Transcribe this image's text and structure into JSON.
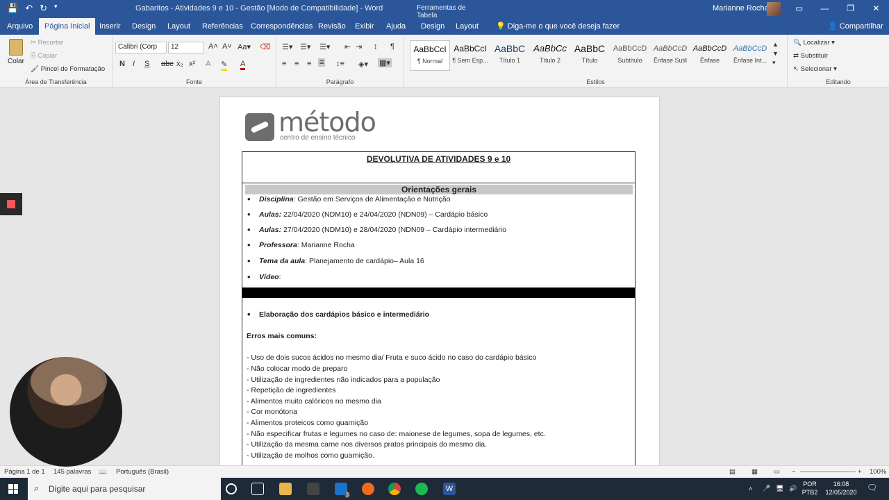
{
  "titlebar": {
    "doc_title": "Gabaritos - Atividades 9 e 10 - Gestão [Modo de Compatibilidade] - Word",
    "context_tools": "Ferramentas de Tabela",
    "user_name": "Marianne Rocha"
  },
  "tabs": [
    "Arquivo",
    "Página Inicial",
    "Inserir",
    "Design",
    "Layout",
    "Referências",
    "Correspondências",
    "Revisão",
    "Exibir",
    "Ajuda",
    "Design",
    "Layout"
  ],
  "tell_me": "Diga-me o que você deseja fazer",
  "share": "Compartilhar",
  "clipboard": {
    "paste": "Colar",
    "cut": "Recortar",
    "copy": "Copiar",
    "format_painter": "Pincel de Formatação",
    "label": "Área de Transferência"
  },
  "font": {
    "name": "Calibri (Corp",
    "size": "12",
    "label": "Fonte"
  },
  "paragraph": {
    "label": "Parágrafo"
  },
  "styles": {
    "label": "Estilos",
    "items": [
      {
        "preview": "AaBbCcI",
        "name": "¶ Normal"
      },
      {
        "preview": "AaBbCcI",
        "name": "¶ Sem Esp..."
      },
      {
        "preview": "AaBbC",
        "name": "Título 1"
      },
      {
        "preview": "AaBbCc",
        "name": "Título 2"
      },
      {
        "preview": "AaBbC",
        "name": "Título"
      },
      {
        "preview": "AaBbCcD",
        "name": "Subtítulo"
      },
      {
        "preview": "AaBbCcD",
        "name": "Ênfase Sutil"
      },
      {
        "preview": "AaBbCcD",
        "name": "Ênfase"
      },
      {
        "preview": "AaBbCcD",
        "name": "Ênfase Int..."
      }
    ]
  },
  "editing": {
    "find": "Localizar",
    "replace": "Substituir",
    "select": "Selecionar",
    "label": "Editando"
  },
  "document": {
    "logo_word": "método",
    "logo_sub": "centro de ensino técnico",
    "heading": "DEVOLUTIVA DE ATIVIDADES 9 e 10",
    "section": "Orientações gerais",
    "bullets": [
      {
        "label": "Disciplina",
        "sep": ": ",
        "text": "Gestão em Serviços de Alimentação e Nutrição"
      },
      {
        "label": "Aulas:",
        "sep": " ",
        "text": "22/04/2020 (NDM10) e 24/04/2020 (NDN09) – Cardápio básico"
      },
      {
        "label": "Aulas:",
        "sep": " ",
        "text": "27/04/2020 (NDM10) e 28/04/2020 (NDN09 – Cardápio intermediário"
      },
      {
        "label": "Professora",
        "sep": ": ",
        "text": "Marianne Rocha"
      },
      {
        "label": "Tema da aula",
        "sep": ": ",
        "text": "Planejamento de cardápio– Aula 16"
      },
      {
        "label": "Vídeo",
        "sep": ":",
        "text": ""
      }
    ],
    "task_bullet": "Elaboração dos cardápios básico e intermediário",
    "errors_heading": "Erros mais comuns:",
    "errors": [
      "- Uso de dois sucos ácidos no mesmo dia/ Fruta e suco ácido no caso do cardápio básico",
      "- Não colocar modo de preparo",
      "- Utilização de ingredientes não indicados para a população",
      "- Repetição de ingredientes",
      "- Alimentos muito calóricos no mesmo dia",
      "- Cor monótona",
      "- Alimentos proteicos como guarnição",
      "- Não especificar frutas e legumes no caso de: maionese de legumes, sopa de legumes, etc.",
      "- Utilização da mesma carne nos diversos pratos principais do mesmo dia.",
      "- Utilização de molhos como guarnição."
    ]
  },
  "status": {
    "page": "Página 1 de 1",
    "words": "145 palavras",
    "language": "Português (Brasil)",
    "zoom": "100%"
  },
  "taskbar": {
    "search_placeholder": "Digite aqui para pesquisar",
    "lang_top": "POR",
    "lang_bottom": "PTB2",
    "time": "16:08",
    "date": "12/05/2020",
    "mail_badge": "3"
  }
}
